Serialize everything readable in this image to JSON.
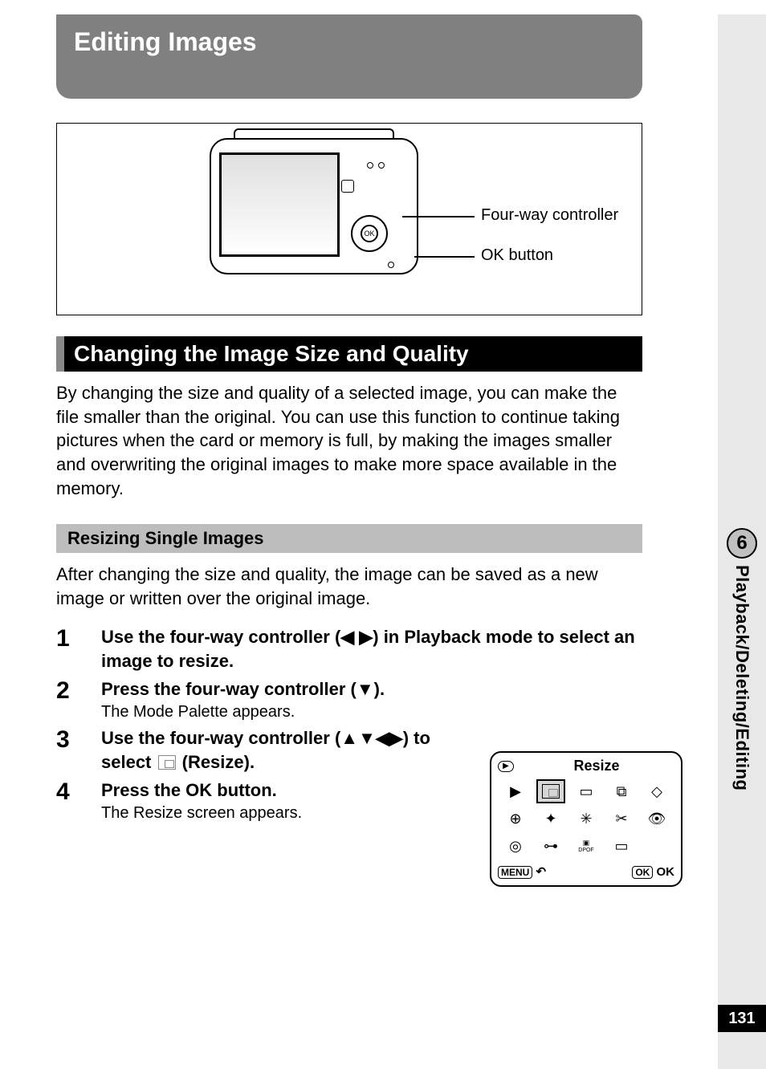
{
  "chapter_title": "Editing Images",
  "figure": {
    "callout1": "Four-way controller",
    "callout2": "OK button"
  },
  "section_title": "Changing the Image Size and Quality",
  "section_body": "By changing the size and quality of a selected image, you can make the file smaller than the original. You can use this function to continue taking pictures when the card or memory is full, by making the images smaller and overwriting the original images to make more space available in the memory.",
  "subhead": "Resizing Single Images",
  "subbody": "After changing the size and quality, the image can be saved as a new image or written over the original image.",
  "steps": {
    "s1": {
      "num": "1",
      "title_a": "Use the four-way controller (",
      "title_b": ") in Playback mode to select an image to resize."
    },
    "s2": {
      "num": "2",
      "title_a": "Press the four-way controller (",
      "title_b": ").",
      "desc": "The Mode Palette appears."
    },
    "s3": {
      "num": "3",
      "title_a": "Use the four-way controller (",
      "title_b": ") to select ",
      "title_c": " (Resize)."
    },
    "s4": {
      "num": "4",
      "title": "Press the OK button.",
      "desc": "The Resize screen appears."
    }
  },
  "palette": {
    "title": "Resize",
    "menu_label": "MENU",
    "ok_label": "OK",
    "ok_text": "OK"
  },
  "side": {
    "chapter_num": "6",
    "label": "Playback/Deleting/Editing"
  },
  "page_number": "131"
}
